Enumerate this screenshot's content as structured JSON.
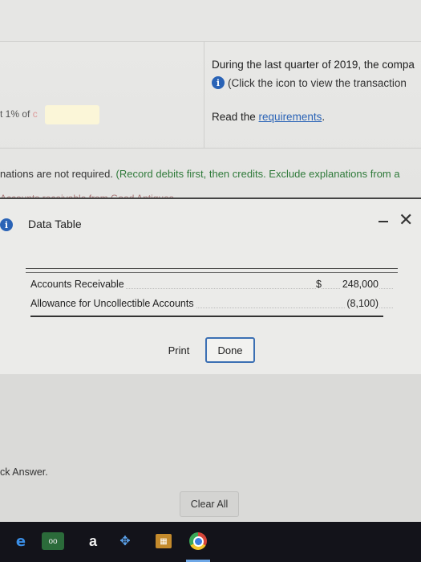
{
  "question": {
    "left_fragment": "t 1% of",
    "left_faint": " c",
    "intro": "During the last quarter of 2019, the compa",
    "info_link": "(Click the icon to view the transaction",
    "req_prefix": "Read the ",
    "req_link": "requirements",
    "req_suffix": ".",
    "instructions_a": "nations are not required. ",
    "instructions_b": "(Record debits first, then credits. Exclude explanations from a",
    "cut_line": "Accounts receivable from Good Antiques"
  },
  "modal": {
    "title": "Data Table",
    "minimize_icon": "minimize-icon",
    "close_glyph": "✕",
    "rows": [
      {
        "label": "Accounts Receivable",
        "currency": "$",
        "amount": "248,000"
      },
      {
        "label": "Allowance for Uncollectible Accounts",
        "currency": "",
        "amount": "(8,100)"
      }
    ],
    "print_label": "Print",
    "done_label": "Done"
  },
  "footer": {
    "answer_fragment": "ck Answer.",
    "clear_all": "Clear All"
  },
  "taskbar": {
    "edge": "e",
    "trip": "oo",
    "amazon": "a",
    "dropbox": "✥",
    "store": "▦"
  },
  "colors": {
    "link": "#2a63b6",
    "done_border": "#3b6fb3",
    "instruction_green": "#2f7a3a"
  }
}
